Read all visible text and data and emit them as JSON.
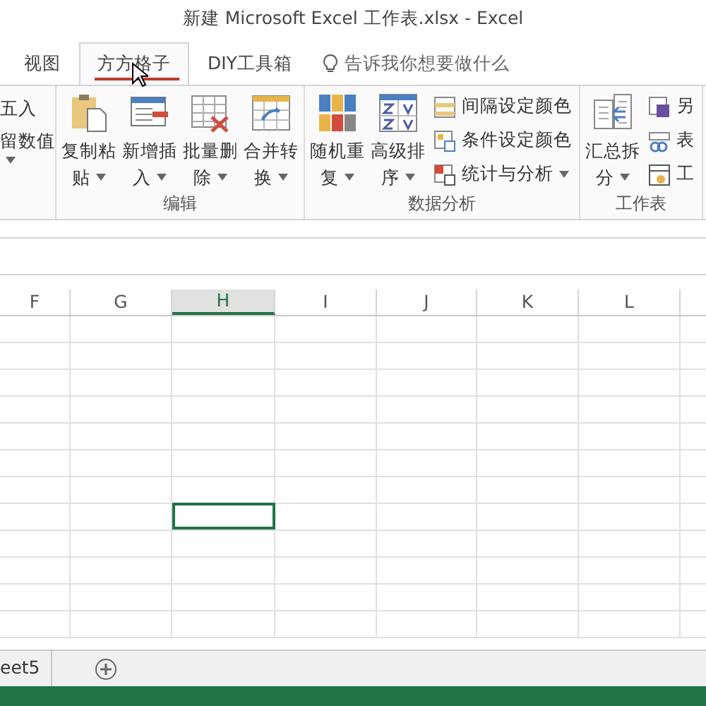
{
  "window": {
    "title": "新建 Microsoft Excel 工作表.xlsx - Excel"
  },
  "tabs": [
    {
      "label": "视图",
      "selected": false
    },
    {
      "label": "方方格子",
      "selected": true
    },
    {
      "label": "DIY工具箱",
      "selected": false
    }
  ],
  "tell_me": {
    "placeholder": "告诉我你想要做什么"
  },
  "ribbon": {
    "groups": [
      {
        "items": [
          {
            "kind": "text",
            "lines": [
              "五入",
              "留数值"
            ],
            "dropdown": true
          }
        ]
      },
      {
        "title": "编辑",
        "items": [
          {
            "kind": "large",
            "lines": [
              "复制粘",
              "贴"
            ],
            "dropdown": true
          },
          {
            "kind": "large",
            "lines": [
              "新增插",
              "入"
            ],
            "dropdown": true
          },
          {
            "kind": "large",
            "lines": [
              "批量删",
              "除"
            ],
            "dropdown": true
          },
          {
            "kind": "large",
            "lines": [
              "合并转",
              "换"
            ],
            "dropdown": true
          }
        ]
      },
      {
        "title": "数据分析",
        "items": [
          {
            "kind": "large",
            "lines": [
              "随机重",
              "复"
            ],
            "dropdown": true
          },
          {
            "kind": "large",
            "lines": [
              "高级排",
              "序"
            ],
            "dropdown": true
          },
          {
            "kind": "small",
            "entries": [
              {
                "label": "间隔设定颜色",
                "dropdown": false
              },
              {
                "label": "条件设定颜色",
                "dropdown": false
              },
              {
                "label": "统计与分析",
                "dropdown": true
              }
            ]
          }
        ]
      },
      {
        "title": "工作表",
        "items": [
          {
            "kind": "large",
            "lines": [
              "汇总拆",
              "分"
            ],
            "dropdown": true
          },
          {
            "kind": "small",
            "entries": [
              {
                "label": "另",
                "dropdown": false
              },
              {
                "label": "表",
                "dropdown": false
              },
              {
                "label": "工",
                "dropdown": false
              }
            ]
          }
        ]
      }
    ]
  },
  "columns": [
    {
      "label": "F",
      "selected": false
    },
    {
      "label": "G",
      "selected": false
    },
    {
      "label": "H",
      "selected": true
    },
    {
      "label": "I",
      "selected": false
    },
    {
      "label": "J",
      "selected": false
    },
    {
      "label": "K",
      "selected": false
    },
    {
      "label": "L",
      "selected": false
    }
  ],
  "rows": [
    {
      "selected": false
    },
    {
      "selected": false
    },
    {
      "selected": false
    },
    {
      "selected": false
    },
    {
      "selected": false
    },
    {
      "selected": false
    },
    {
      "selected": false
    },
    {
      "selected": true
    },
    {
      "selected": false
    },
    {
      "selected": false
    },
    {
      "selected": false
    },
    {
      "selected": false
    }
  ],
  "sheet_tabs": [
    {
      "label": "eet5"
    }
  ]
}
